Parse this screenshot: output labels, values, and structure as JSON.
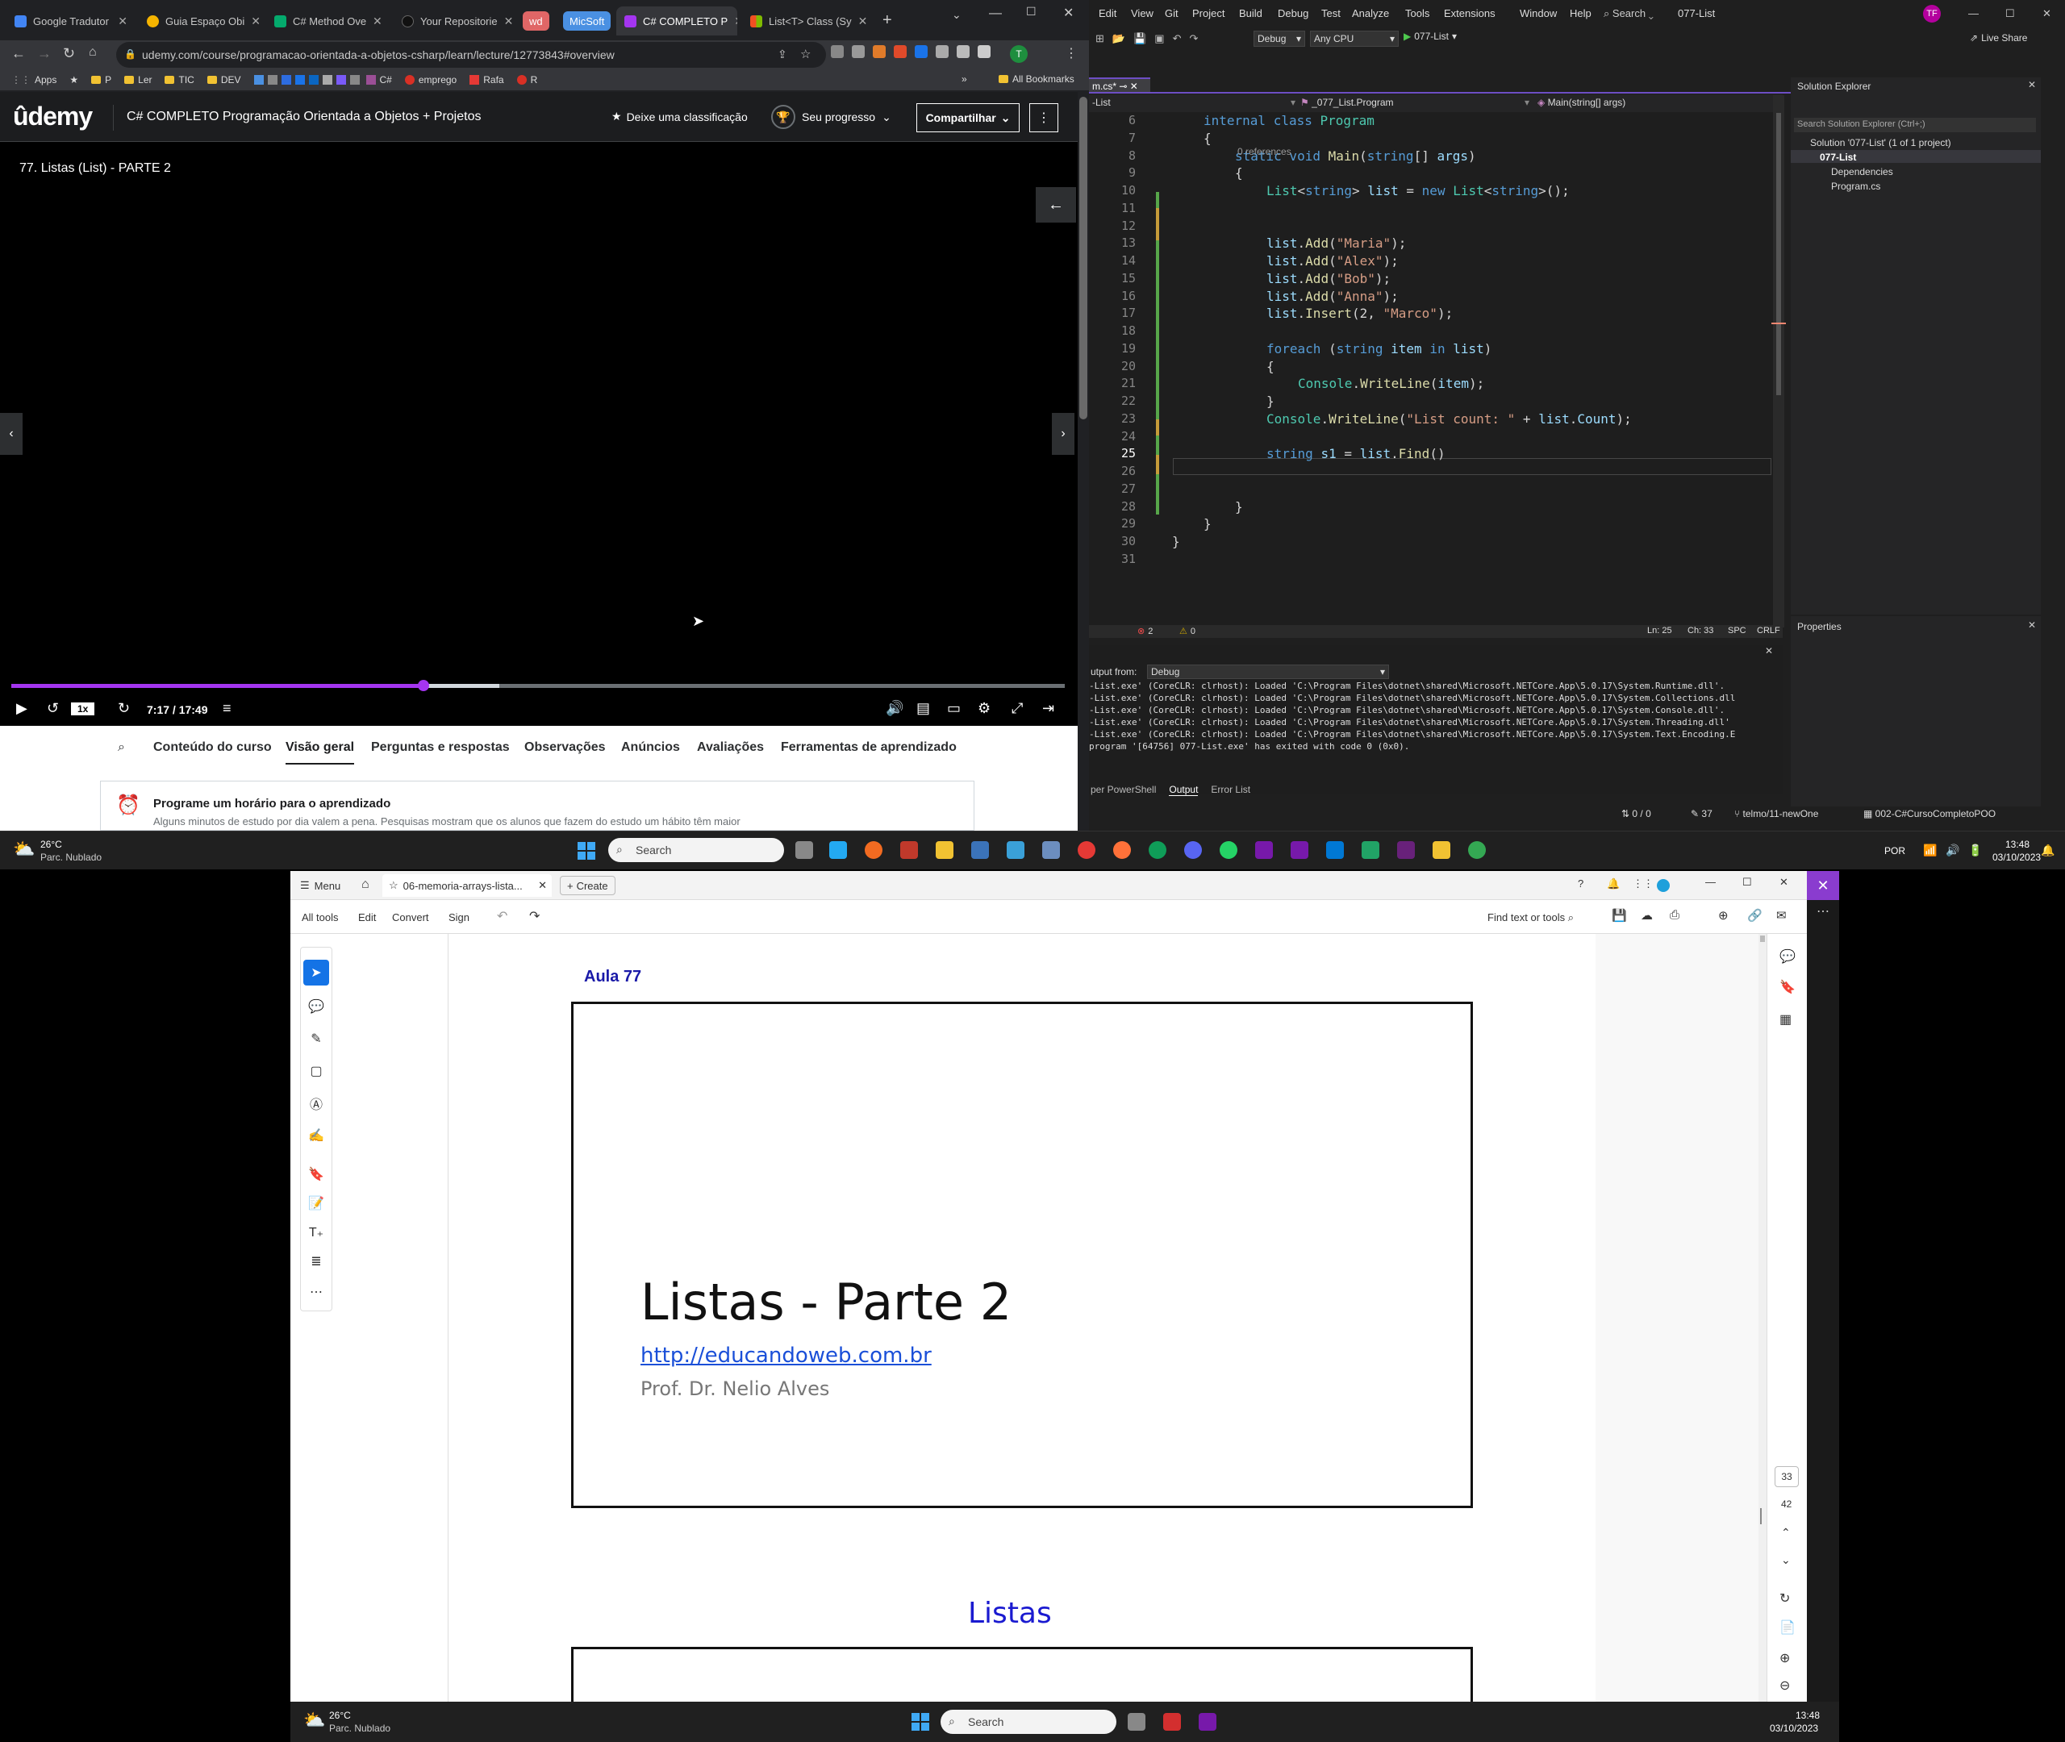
{
  "chrome": {
    "tabs": [
      {
        "label": "Google Tradutor"
      },
      {
        "label": "Guia Espaço Obi"
      },
      {
        "label": "C# Method Ove"
      },
      {
        "label": "Your Repositorie"
      },
      {
        "label": "C# COMPLETO P"
      },
      {
        "label": "List<T> Class (Sy"
      }
    ],
    "pill_wd": "wd",
    "pill_micsoft": "MicSoft",
    "url": "udemy.com/course/programacao-orientada-a-objetos-csharp/learn/lecture/12773843#overview",
    "bookmarks": [
      "Apps",
      "P",
      "Ler",
      "TIC",
      "DEV",
      "C#",
      "emprego",
      "Rafa",
      "R"
    ],
    "all_bookmarks": "All Bookmarks",
    "avatar": "T"
  },
  "udemy": {
    "logo": "ûdemy",
    "course_title": "C# COMPLETO Programação Orientada a Objetos + Projetos",
    "rate": "Deixe uma classificação",
    "progress": "Seu progresso",
    "share": "Compartilhar",
    "video_title": "77. Listas (List) - PARTE 2",
    "speed": "1x",
    "time": "7:17 / 17:49",
    "tabs": [
      "Conteúdo do curso",
      "Visão geral",
      "Perguntas e respostas",
      "Observações",
      "Anúncios",
      "Avaliações",
      "Ferramentas de aprendizado"
    ],
    "card_title": "Programe um horário para o aprendizado",
    "card_text": "Alguns minutos de estudo por dia valem a pena. Pesquisas mostram que os alunos que fazem do estudo um hábito têm maior"
  },
  "vs": {
    "menu": [
      "Edit",
      "View",
      "Git",
      "Project",
      "Build",
      "Debug",
      "Test",
      "Analyze",
      "Tools",
      "Extensions",
      "Window",
      "Help"
    ],
    "search": "Search",
    "project_title": "077-List",
    "avatar": "TF",
    "config": "Debug",
    "platform": "Any CPU",
    "run_target": "077-List",
    "live_share": "Live Share",
    "doc_tab": "m.cs*",
    "nav_left": "-List",
    "nav_mid": "_077_List.Program",
    "nav_right": "Main(string[] args)",
    "code_lines": [
      {
        "n": "6",
        "parts": [
          [
            "kw",
            "internal class "
          ],
          [
            "ty",
            "Program"
          ]
        ],
        "indent": 0
      },
      {
        "n": "7",
        "parts": [
          [
            "",
            "{"
          ]
        ],
        "indent": 0
      },
      {
        "n": "8",
        "parts": [
          [
            "kw",
            "static void "
          ],
          [
            "mt",
            "Main"
          ],
          [
            "",
            "("
          ],
          [
            "kw",
            "string"
          ],
          [
            "",
            "[] "
          ],
          [
            "vr",
            "args"
          ],
          [
            "",
            ")"
          ]
        ],
        "indent": 1
      },
      {
        "n": "9",
        "parts": [
          [
            "",
            "{"
          ]
        ],
        "indent": 1
      },
      {
        "n": "10",
        "parts": [
          [
            "ty",
            "List"
          ],
          [
            "",
            "<"
          ],
          [
            "kw",
            "string"
          ],
          [
            "",
            "> "
          ],
          [
            "vr",
            "list"
          ],
          [
            "",
            " = "
          ],
          [
            "kw",
            "new "
          ],
          [
            "ty",
            "List"
          ],
          [
            "",
            "<"
          ],
          [
            "kw",
            "string"
          ],
          [
            "",
            ">();"
          ]
        ],
        "indent": 2
      },
      {
        "n": "11",
        "parts": [],
        "indent": 2
      },
      {
        "n": "12",
        "parts": [],
        "indent": 2
      },
      {
        "n": "13",
        "parts": [
          [
            "vr",
            "list"
          ],
          [
            "",
            "."
          ],
          [
            "mt",
            "Add"
          ],
          [
            "",
            "("
          ],
          [
            "str",
            "\"Maria\""
          ],
          [
            "",
            ");"
          ]
        ],
        "indent": 2
      },
      {
        "n": "14",
        "parts": [
          [
            "vr",
            "list"
          ],
          [
            "",
            "."
          ],
          [
            "mt",
            "Add"
          ],
          [
            "",
            "("
          ],
          [
            "str",
            "\"Alex\""
          ],
          [
            "",
            ");"
          ]
        ],
        "indent": 2
      },
      {
        "n": "15",
        "parts": [
          [
            "vr",
            "list"
          ],
          [
            "",
            "."
          ],
          [
            "mt",
            "Add"
          ],
          [
            "",
            "("
          ],
          [
            "str",
            "\"Bob\""
          ],
          [
            "",
            ");"
          ]
        ],
        "indent": 2
      },
      {
        "n": "16",
        "parts": [
          [
            "vr",
            "list"
          ],
          [
            "",
            "."
          ],
          [
            "mt",
            "Add"
          ],
          [
            "",
            "("
          ],
          [
            "str",
            "\"Anna\""
          ],
          [
            "",
            ");"
          ]
        ],
        "indent": 2
      },
      {
        "n": "17",
        "parts": [
          [
            "vr",
            "list"
          ],
          [
            "",
            "."
          ],
          [
            "mt",
            "Insert"
          ],
          [
            "",
            "(2, "
          ],
          [
            "str",
            "\"Marco\""
          ],
          [
            "",
            ");"
          ]
        ],
        "indent": 2
      },
      {
        "n": "18",
        "parts": [],
        "indent": 2
      },
      {
        "n": "19",
        "parts": [
          [
            "kw",
            "foreach "
          ],
          [
            "",
            "("
          ],
          [
            "kw",
            "string "
          ],
          [
            "vr",
            "item "
          ],
          [
            "kw",
            "in "
          ],
          [
            "vr",
            "list"
          ],
          [
            "",
            ")"
          ]
        ],
        "indent": 2
      },
      {
        "n": "20",
        "parts": [
          [
            "",
            "{"
          ]
        ],
        "indent": 2
      },
      {
        "n": "21",
        "parts": [
          [
            "ty",
            "Console"
          ],
          [
            "",
            "."
          ],
          [
            "mt",
            "WriteLine"
          ],
          [
            "",
            "("
          ],
          [
            "vr",
            "item"
          ],
          [
            "",
            ");"
          ]
        ],
        "indent": 3
      },
      {
        "n": "22",
        "parts": [
          [
            "",
            "}"
          ]
        ],
        "indent": 2
      },
      {
        "n": "23",
        "parts": [
          [
            "ty",
            "Console"
          ],
          [
            "",
            "."
          ],
          [
            "mt",
            "WriteLine"
          ],
          [
            "",
            "("
          ],
          [
            "str",
            "\"List count: \""
          ],
          [
            "",
            " + "
          ],
          [
            "vr",
            "list"
          ],
          [
            "",
            "."
          ],
          [
            "vr",
            "Count"
          ],
          [
            "",
            ");"
          ]
        ],
        "indent": 2
      },
      {
        "n": "24",
        "parts": [],
        "indent": 2
      },
      {
        "n": "25",
        "parts": [
          [
            "kw",
            "string "
          ],
          [
            "vr",
            "s1"
          ],
          [
            "",
            " = "
          ],
          [
            "vr",
            "list"
          ],
          [
            "",
            "."
          ],
          [
            "mt",
            "Find"
          ],
          [
            "",
            "()"
          ]
        ],
        "indent": 2
      },
      {
        "n": "26",
        "parts": [],
        "indent": 2
      },
      {
        "n": "27",
        "parts": [],
        "indent": 2
      },
      {
        "n": "28",
        "parts": [
          [
            "",
            "}"
          ]
        ],
        "indent": 1
      },
      {
        "n": "29",
        "parts": [
          [
            "",
            "}"
          ]
        ],
        "indent": 0
      },
      {
        "n": "30",
        "parts": [
          [
            "",
            "}"
          ]
        ],
        "indent": -1
      },
      {
        "n": "31",
        "parts": [],
        "indent": -1
      }
    ],
    "references": "0 references",
    "errors": "2",
    "warnings": "0",
    "ln": "Ln: 25",
    "ch": "Ch: 33",
    "spc": "SPC",
    "crlf": "CRLF",
    "se_title": "Solution Explorer",
    "se_search": "Search Solution Explorer (Ctrl+;)",
    "se_items": [
      "Solution '077-List' (1 of 1 project)",
      "077-List",
      "Dependencies",
      "Program.cs"
    ],
    "props_title": "Properties",
    "output_from": "utput from:",
    "output_source": "Debug",
    "output_lines": [
      "-List.exe' (CoreCLR: clrhost): Loaded 'C:\\Program Files\\dotnet\\shared\\Microsoft.NETCore.App\\5.0.17\\System.Runtime.dll'.",
      "-List.exe' (CoreCLR: clrhost): Loaded 'C:\\Program Files\\dotnet\\shared\\Microsoft.NETCore.App\\5.0.17\\System.Collections.dll",
      "-List.exe' (CoreCLR: clrhost): Loaded 'C:\\Program Files\\dotnet\\shared\\Microsoft.NETCore.App\\5.0.17\\System.Console.dll'.",
      "-List.exe' (CoreCLR: clrhost): Loaded 'C:\\Program Files\\dotnet\\shared\\Microsoft.NETCore.App\\5.0.17\\System.Threading.dll'",
      "-List.exe' (CoreCLR: clrhost): Loaded 'C:\\Program Files\\dotnet\\shared\\Microsoft.NETCore.App\\5.0.17\\System.Text.Encoding.E",
      "program '[64756] 077-List.exe' has exited with code 0 (0x0)."
    ],
    "bottom_tabs": [
      "per PowerShell",
      "Output",
      "Error List"
    ],
    "status_changes": "0 / 0",
    "status_pen": "37",
    "status_branch": "telmo/11-newOne",
    "status_repo": "002-C#CursoCompletoPOO"
  },
  "taskbar": {
    "temp": "26°C",
    "weather": "Parc. Nublado",
    "search": "Search",
    "lang": "POR",
    "time": "13:48",
    "date": "03/10/2023"
  },
  "acrobat": {
    "menu": "Menu",
    "tab": "06-memoria-arrays-lista...",
    "create": "Create",
    "tools": [
      "All tools",
      "Edit",
      "Convert",
      "Sign"
    ],
    "find": "Find text or tools",
    "aula": "Aula 77",
    "slide_title": "Listas - Parte 2",
    "slide_link": "http://educandoweb.com.br",
    "slide_author": "Prof. Dr. Nelio Alves",
    "next_heading": "Listas",
    "page_num": "33",
    "page_total": "42"
  },
  "taskbar2": {
    "temp": "26°C",
    "weather": "Parc. Nublado",
    "search": "Search",
    "time": "13:48",
    "date": "03/10/2023"
  },
  "colors": {
    "udemy_purple": "#a435f0",
    "vs_purple": "#6d4ec4",
    "link": "#1a4fd8",
    "aula": "#1a1aa8"
  }
}
